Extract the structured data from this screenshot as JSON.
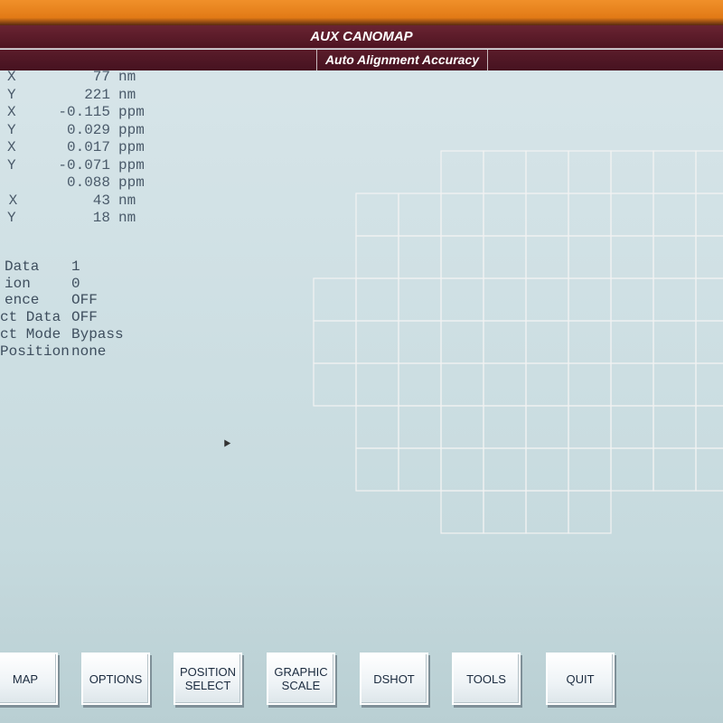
{
  "header": {
    "title": "AUX CANOMAP",
    "subtitle": "Auto Alignment Accuracy"
  },
  "readouts": [
    {
      "label": "X",
      "value": "77",
      "unit": "nm"
    },
    {
      "label": "Y",
      "value": "221",
      "unit": "nm"
    },
    {
      "label": "X",
      "value": "-0.115",
      "unit": "ppm"
    },
    {
      "label": "Y",
      "value": "0.029",
      "unit": "ppm"
    },
    {
      "label": "X",
      "value": "0.017",
      "unit": "ppm"
    },
    {
      "label": "Y",
      "value": "-0.071",
      "unit": "ppm"
    },
    {
      "label": "",
      "value": "0.088",
      "unit": "ppm"
    },
    {
      "label": " X",
      "value": "43",
      "unit": "nm"
    },
    {
      "label": "Y",
      "value": "18",
      "unit": "nm"
    }
  ],
  "parameters": [
    {
      "label": "Data",
      "value": "1"
    },
    {
      "label": "ion",
      "value": "0"
    },
    {
      "label": "ence",
      "value": "OFF"
    },
    {
      "label": "ct Data",
      "value": "OFF"
    },
    {
      "label": "ct Mode",
      "value": "Bypass"
    },
    {
      "label": "Position",
      "value": "none"
    }
  ],
  "colors": {
    "wafer_fill": "#2e1418",
    "wafer_edge": "#c23a4a",
    "grid_line": "#f2f2f2",
    "vector": "#f2f01a"
  },
  "wafer_map": {
    "vector_length_fraction": 0.8,
    "vector_angle_deg_from_vertical": 22
  },
  "buttons": [
    {
      "id": "map",
      "label": "MAP"
    },
    {
      "id": "options",
      "label": "OPTIONS"
    },
    {
      "id": "position-select",
      "label": "POSITION\nSELECT"
    },
    {
      "id": "graphic-scale",
      "label": "GRAPHIC\nSCALE"
    },
    {
      "id": "dshot",
      "label": "DSHOT"
    },
    {
      "id": "tools",
      "label": "TOOLS"
    },
    {
      "id": "quit",
      "label": "QUIT"
    }
  ]
}
